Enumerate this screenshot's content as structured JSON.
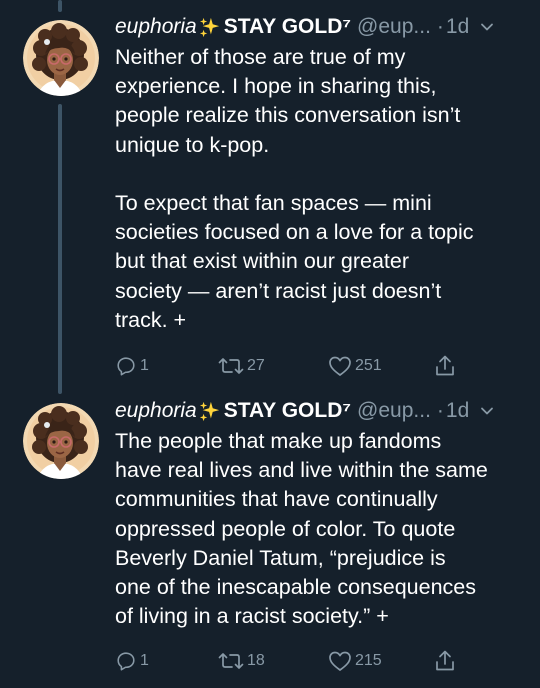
{
  "tweets": [
    {
      "display_name": "euphoria",
      "name_tail": "STAY GOLD⁷",
      "handle": "@eup...",
      "separator": "·",
      "time": "1d",
      "text": "Neither of those are true of my\nexperience. I hope in sharing this,\npeople realize this conversation isn’t\nunique to k-pop.\n\nTo expect that fan spaces — mini\nsocieties focused on a love for a topic\nbut that exist within our greater\nsociety — aren’t racist just doesn’t\ntrack. +",
      "reply_count": "1",
      "retweet_count": "27",
      "like_count": "251"
    },
    {
      "display_name": "euphoria",
      "name_tail": "STAY GOLD⁷",
      "handle": "@eup...",
      "separator": "·",
      "time": "1d",
      "text": "The people that make up fandoms\nhave real lives and live within the same\ncommunities that have continually\noppressed people of color. To quote\nBeverly Daniel Tatum, “prejudice is\none of the inescapable consequences\nof living in a racist society.” +",
      "reply_count": "1",
      "retweet_count": "18",
      "like_count": "215"
    }
  ],
  "icons": {
    "sparkle": "sparkles-icon",
    "caret": "chevron-down-icon",
    "reply": "reply-icon",
    "retweet": "retweet-icon",
    "like": "heart-icon",
    "share": "share-icon"
  },
  "colors": {
    "background": "#15202b",
    "secondary_text": "#8899a6",
    "thread_line": "#3d5466",
    "sparkle": "#ffd43b"
  }
}
